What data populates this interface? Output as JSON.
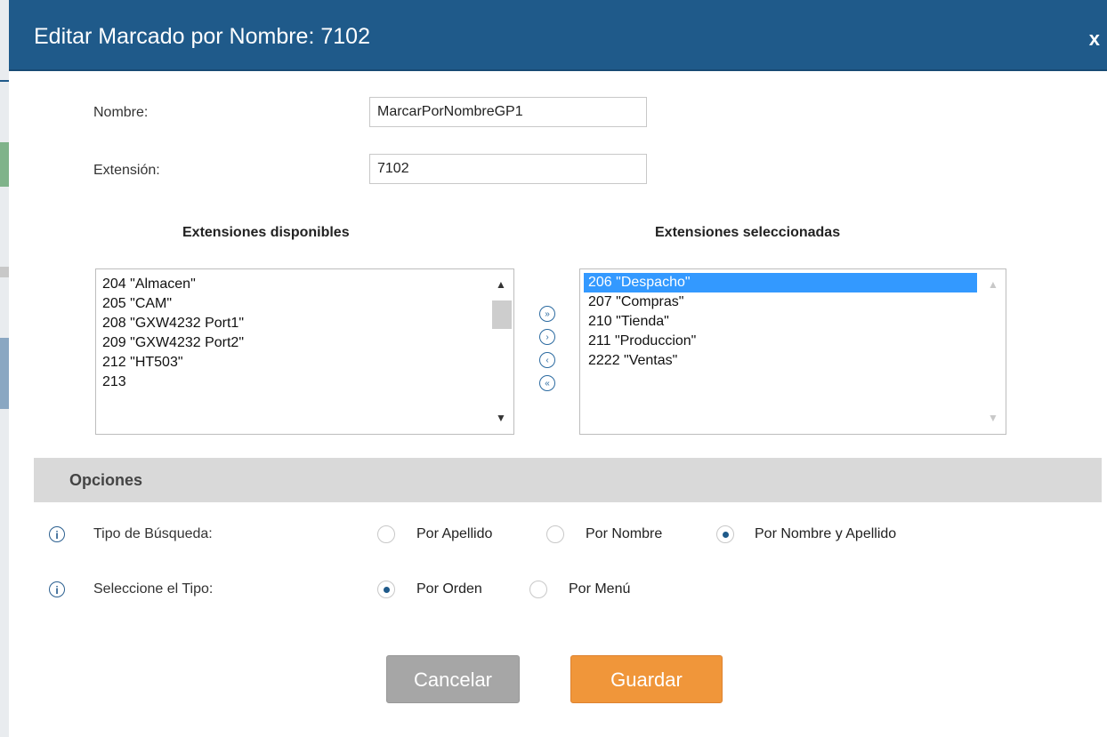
{
  "dialog": {
    "title": "Editar Marcado por Nombre: 7102",
    "close_label": "x"
  },
  "form": {
    "name_label": "Nombre:",
    "name_value": "MarcarPorNombreGP1",
    "extension_label": "Extensión:",
    "extension_value": "7102"
  },
  "available": {
    "header": "Extensiones disponibles",
    "items": [
      "204 \"Almacen\"",
      "205 \"CAM\"",
      "208 \"GXW4232 Port1\"",
      "209 \"GXW4232 Port2\"",
      "212 \"HT503\"",
      "213"
    ]
  },
  "selected": {
    "header": "Extensiones seleccionadas",
    "items": [
      "206 \"Despacho\"",
      "207 \"Compras\"",
      "210 \"Tienda\"",
      "211 \"Produccion\"",
      "2222 \"Ventas\""
    ],
    "highlighted_index": 0
  },
  "move_buttons": {
    "add_all": "»",
    "add": "›",
    "remove": "‹",
    "remove_all": "«"
  },
  "options": {
    "section_title": "Opciones",
    "search_type": {
      "label": "Tipo de Búsqueda:",
      "options": [
        "Por Apellido",
        "Por Nombre",
        "Por Nombre y Apellido"
      ],
      "selected": "Por Nombre y Apellido"
    },
    "select_type": {
      "label": "Seleccione el Tipo:",
      "options": [
        "Por Orden",
        "Por Menú"
      ],
      "selected": "Por Orden"
    }
  },
  "buttons": {
    "cancel": "Cancelar",
    "save": "Guardar"
  },
  "colors": {
    "titlebar": "#1f5a8a",
    "selection": "#3399ff",
    "save": "#f0963a",
    "cancel": "#a6a6a6"
  }
}
